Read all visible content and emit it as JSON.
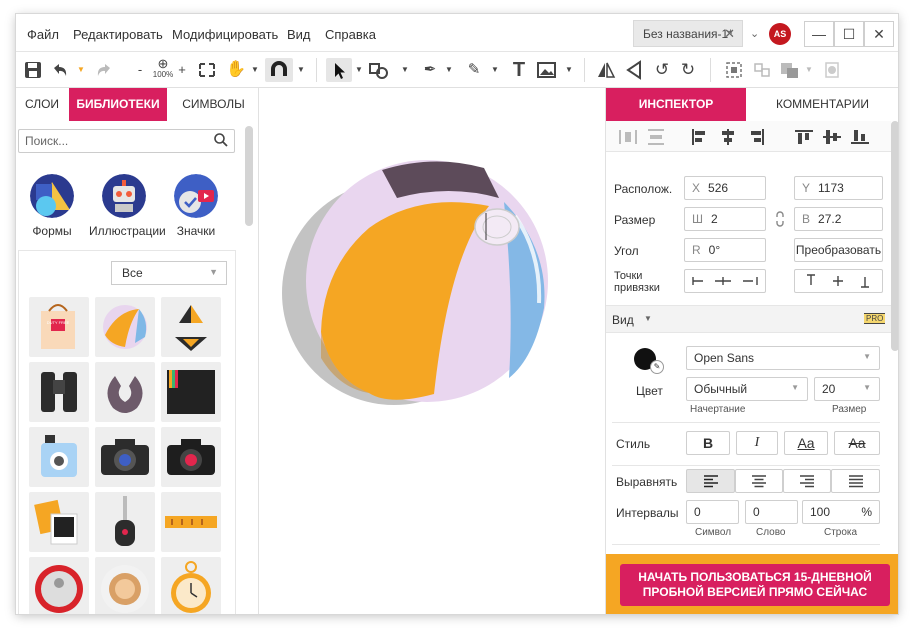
{
  "menu": {
    "file": "Файл",
    "edit": "Редактировать",
    "modify": "Модифицировать",
    "view": "Вид",
    "help": "Справка"
  },
  "document": {
    "title": "Без названия-1*"
  },
  "user": {
    "initials": "AS"
  },
  "toolbar": {
    "zoom_minus": "-",
    "zoom_level": "100%",
    "zoom_plus": "+"
  },
  "left_tabs": {
    "layers": "СЛОИ",
    "libraries": "БИБЛИОТЕКИ",
    "symbols": "СИМВОЛЫ"
  },
  "search": {
    "placeholder": "Поиск..."
  },
  "categories": [
    {
      "label": "Формы",
      "icon": "shapes-icon"
    },
    {
      "label": "Иллюстрации",
      "icon": "robot-icon"
    },
    {
      "label": "Значки",
      "icon": "badges-icon"
    }
  ],
  "library_filter": {
    "selected": "Все"
  },
  "library_items": [
    {
      "name": "duty-free-bag",
      "text": "DUTY FREE"
    },
    {
      "name": "beach-ball",
      "text": ""
    },
    {
      "name": "bikini",
      "text": ""
    },
    {
      "name": "binoculars",
      "text": ""
    },
    {
      "name": "neck-pillow",
      "text": ""
    },
    {
      "name": "photo-frame",
      "text": ""
    },
    {
      "name": "instant-camera",
      "text": ""
    },
    {
      "name": "dslr-camera",
      "text": ""
    },
    {
      "name": "dslr-camera-2",
      "text": ""
    },
    {
      "name": "photos",
      "text": ""
    },
    {
      "name": "car-key",
      "text": ""
    },
    {
      "name": "ruler",
      "text": ""
    },
    {
      "name": "can",
      "text": ""
    },
    {
      "name": "coffee-cup",
      "text": ""
    },
    {
      "name": "pocket-watch",
      "text": ""
    }
  ],
  "inspector_tabs": {
    "inspector": "ИНСПЕКТОР",
    "comments": "КОММЕНТАРИИ"
  },
  "inspector": {
    "position_label": "Располож.",
    "x_prefix": "X",
    "x_value": "526",
    "y_prefix": "Y",
    "y_value": "1173",
    "size_label": "Размер",
    "w_prefix": "Ш",
    "w_value": "2",
    "h_prefix": "В",
    "h_value": "27.2",
    "angle_label": "Угол",
    "r_prefix": "R",
    "angle_value": "0°",
    "transform_button": "Преобразовать",
    "snap_label_1": "Точки",
    "snap_label_2": "привязки",
    "view_label": "Вид",
    "pro_badge": "PRO",
    "font_family": "Open Sans",
    "color_label": "Цвет",
    "font_style": "Обычный",
    "font_style_label": "Начертание",
    "font_size": "20",
    "font_size_label": "Размер",
    "style_label": "Стиль",
    "bold": "B",
    "italic": "I",
    "underline": "Aa",
    "strike": "Aa",
    "align_label": "Выравнять",
    "spacing_label": "Интервалы",
    "char_spacing": "0",
    "word_spacing": "0",
    "line_spacing": "100",
    "line_unit": "%",
    "char_label": "Символ",
    "word_label": "Слово",
    "line_label": "Строка"
  },
  "promo": {
    "line1": "НАЧАТЬ ПОЛЬЗОВАТЬСЯ 15-ДНЕВНОЙ",
    "line2": "ПРОБНОЙ ВЕРСИЕЙ ПРЯМО СЕЙЧАС"
  },
  "colors": {
    "accent": "#d81f5f",
    "promo_bg": "#f5a623",
    "avatar": "#c4181f"
  }
}
